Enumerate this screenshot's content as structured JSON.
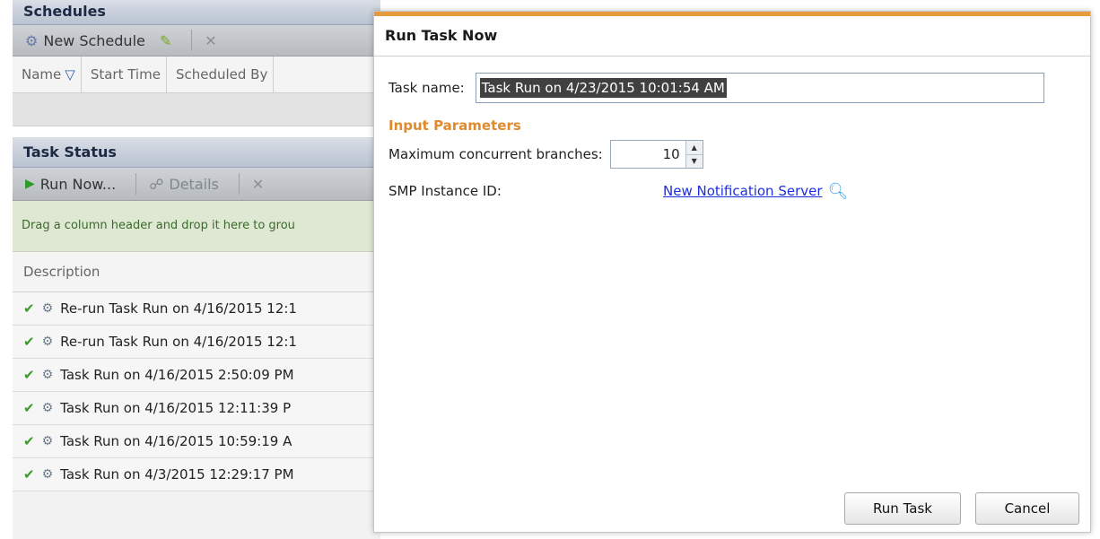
{
  "schedules": {
    "title": "Schedules",
    "toolbar": {
      "new_schedule": "New Schedule"
    },
    "columns": [
      "Name",
      "Start Time",
      "Scheduled By"
    ]
  },
  "task_status": {
    "title": "Task Status",
    "toolbar": {
      "run_now": "Run Now...",
      "details": "Details"
    },
    "group_hint": "Drag a column header and drop it here to grou",
    "description_header": "Description",
    "rows": [
      "Re-run Task Run on 4/16/2015 12:1",
      "Re-run Task Run on 4/16/2015 12:1",
      "Task Run on 4/16/2015 2:50:09 PM",
      "Task Run on 4/16/2015 12:11:39 P",
      "Task Run on 4/16/2015 10:59:19 A",
      "Task Run on 4/3/2015 12:29:17 PM"
    ]
  },
  "dialog": {
    "title": "Run Task Now",
    "task_name_label": "Task name:",
    "task_name_value": "Task Run on 4/23/2015 10:01:54 AM",
    "section_title": "Input Parameters",
    "max_branches_label": "Maximum concurrent branches:",
    "max_branches_value": "10",
    "smp_label": "SMP Instance ID:",
    "smp_link": "New Notification Server",
    "run_button": "Run Task",
    "cancel_button": "Cancel"
  },
  "colors": {
    "accent": "#e59a3c",
    "link": "#1b2ee0",
    "success": "#3c9a2a"
  },
  "icons": {
    "schedule": "user-clock-icon",
    "edit": "pencil-icon",
    "delete": "close-icon",
    "filter": "funnel-icon",
    "run": "play-icon",
    "details": "details-icon",
    "status_ok": "checkmark-icon",
    "task": "gear-icon",
    "lookup": "magnifier-icon"
  }
}
